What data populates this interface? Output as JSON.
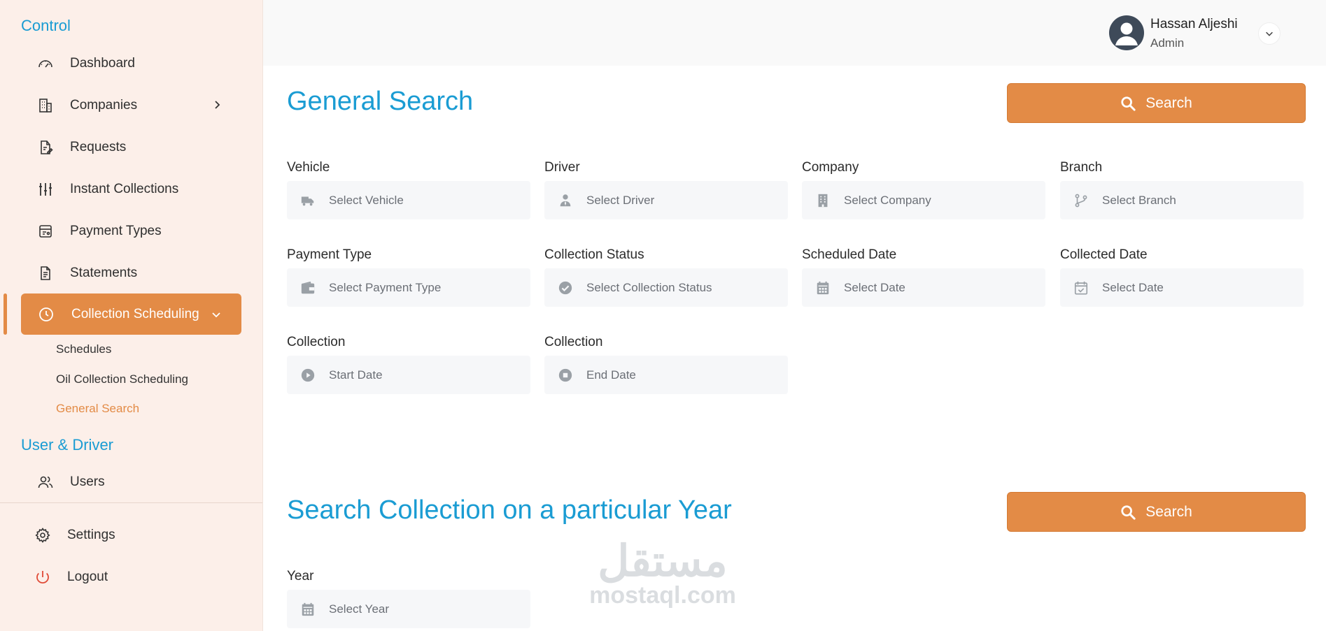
{
  "sidebar": {
    "control_title": "Control",
    "items": {
      "dashboard": "Dashboard",
      "companies": "Companies",
      "requests": "Requests",
      "instant_collections": "Instant Collections",
      "payment_types": "Payment Types",
      "statements": "Statements",
      "collection_scheduling": "Collection Scheduling"
    },
    "sub_items": {
      "schedules": "Schedules",
      "oil_collection_scheduling": "Oil Collection Scheduling",
      "general_search": "General Search"
    },
    "user_driver_title": "User & Driver",
    "users": "Users",
    "settings": "Settings",
    "logout": "Logout"
  },
  "header": {
    "user_name": "Hassan Aljeshi",
    "user_role": "Admin"
  },
  "general_search": {
    "title": "General Search",
    "search_label": "Search",
    "fields": {
      "vehicle": {
        "label": "Vehicle",
        "placeholder": "Select Vehicle",
        "icon": "truck-icon"
      },
      "driver": {
        "label": "Driver",
        "placeholder": "Select Driver",
        "icon": "user-tie-icon"
      },
      "company": {
        "label": "Company",
        "placeholder": "Select Company",
        "icon": "building-icon"
      },
      "branch": {
        "label": "Branch",
        "placeholder": "Select Branch",
        "icon": "branch-icon"
      },
      "payment_type": {
        "label": "Payment Type",
        "placeholder": "Select Payment Type",
        "icon": "wallet-icon"
      },
      "collection_status": {
        "label": "Collection Status",
        "placeholder": "Select Collection Status",
        "icon": "check-circle-icon"
      },
      "scheduled_date": {
        "label": "Scheduled Date",
        "placeholder": "Select Date",
        "icon": "calendar-icon"
      },
      "collected_date": {
        "label": "Collected Date",
        "placeholder": "Select Date",
        "icon": "calendar-check-icon"
      },
      "collection_start": {
        "label": "Collection",
        "placeholder": "Start Date",
        "icon": "play-circle-icon"
      },
      "collection_end": {
        "label": "Collection",
        "placeholder": "End Date",
        "icon": "stop-circle-icon"
      }
    }
  },
  "year_search": {
    "title": "Search Collection on a particular Year",
    "search_label": "Search",
    "year": {
      "label": "Year",
      "placeholder": "Select Year",
      "icon": "calendar-icon"
    }
  },
  "watermark": {
    "arabic": "مستقل",
    "latin": "mostaql.com"
  },
  "colors": {
    "accent": "#e38b46",
    "heading": "#1a9cd3",
    "sidebar_bg": "#fcefe9",
    "field_bg": "#f6f7f9"
  }
}
